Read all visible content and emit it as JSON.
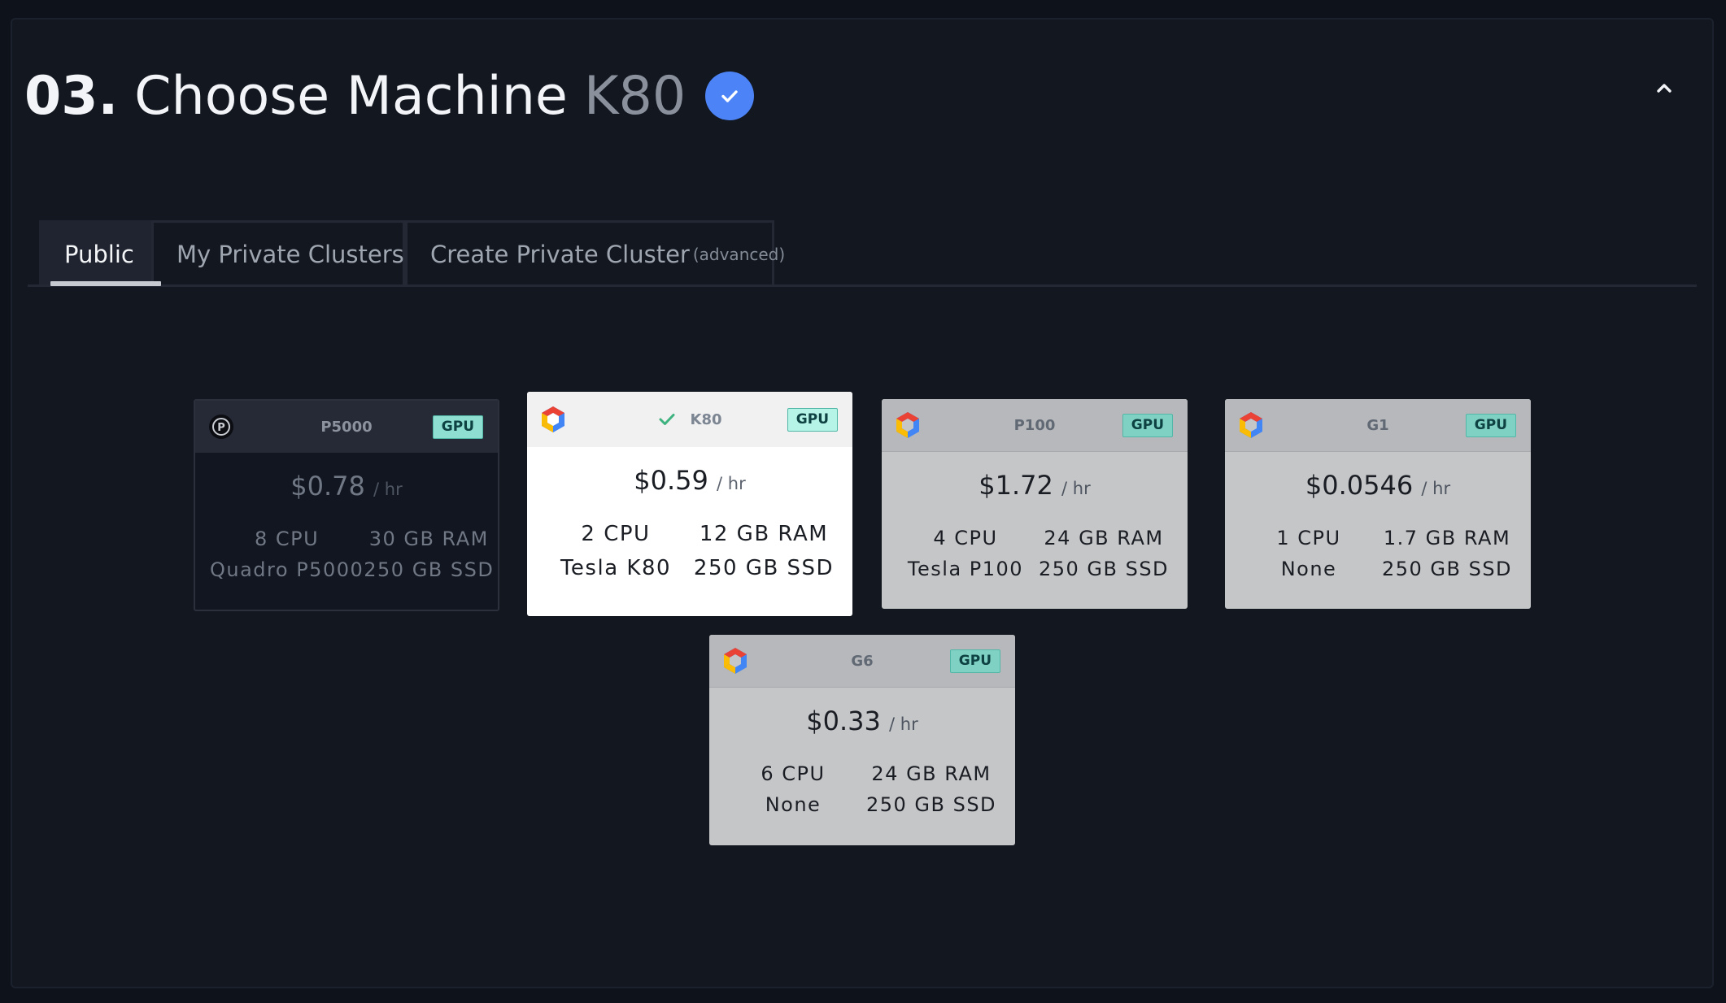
{
  "step": {
    "number": "03.",
    "title": "Choose Machine",
    "selected_machine": "K80",
    "completed_icon": "check-circle-icon",
    "collapse_icon": "chevron-up-icon"
  },
  "tabs": [
    {
      "label": "Public",
      "sub": "",
      "active": true
    },
    {
      "label": "My Private Clusters",
      "sub": "",
      "active": false
    },
    {
      "label": "Create Private Cluster",
      "sub": "(advanced)",
      "active": false
    }
  ],
  "machines": [
    {
      "name": "P5000",
      "provider": "paperspace",
      "badge": "GPU",
      "price": "$0.78",
      "unit": "/ hr",
      "cpu": "8 CPU",
      "ram": "30 GB RAM",
      "gpu": "Quadro P5000",
      "disk": "250 GB SSD",
      "selected": false
    },
    {
      "name": "K80",
      "provider": "google-cloud",
      "badge": "GPU",
      "price": "$0.59",
      "unit": "/ hr",
      "cpu": "2 CPU",
      "ram": "12 GB RAM",
      "gpu": "Tesla K80",
      "disk": "250 GB SSD",
      "selected": true
    },
    {
      "name": "P100",
      "provider": "google-cloud",
      "badge": "GPU",
      "price": "$1.72",
      "unit": "/ hr",
      "cpu": "4 CPU",
      "ram": "24 GB RAM",
      "gpu": "Tesla P100",
      "disk": "250 GB SSD",
      "selected": false
    },
    {
      "name": "G1",
      "provider": "google-cloud",
      "badge": "GPU",
      "price": "$0.0546",
      "unit": "/ hr",
      "cpu": "1 CPU",
      "ram": "1.7 GB RAM",
      "gpu": "None",
      "disk": "250 GB SSD",
      "selected": false
    },
    {
      "name": "G6",
      "provider": "google-cloud",
      "badge": "GPU",
      "price": "$0.33",
      "unit": "/ hr",
      "cpu": "6 CPU",
      "ram": "24 GB RAM",
      "gpu": "None",
      "disk": "250 GB SSD",
      "selected": false
    }
  ],
  "colors": {
    "background": "#121720",
    "accent": "#4c83f6",
    "gpu_badge": "#8edfd2",
    "selected_check": "#3fb37f"
  }
}
